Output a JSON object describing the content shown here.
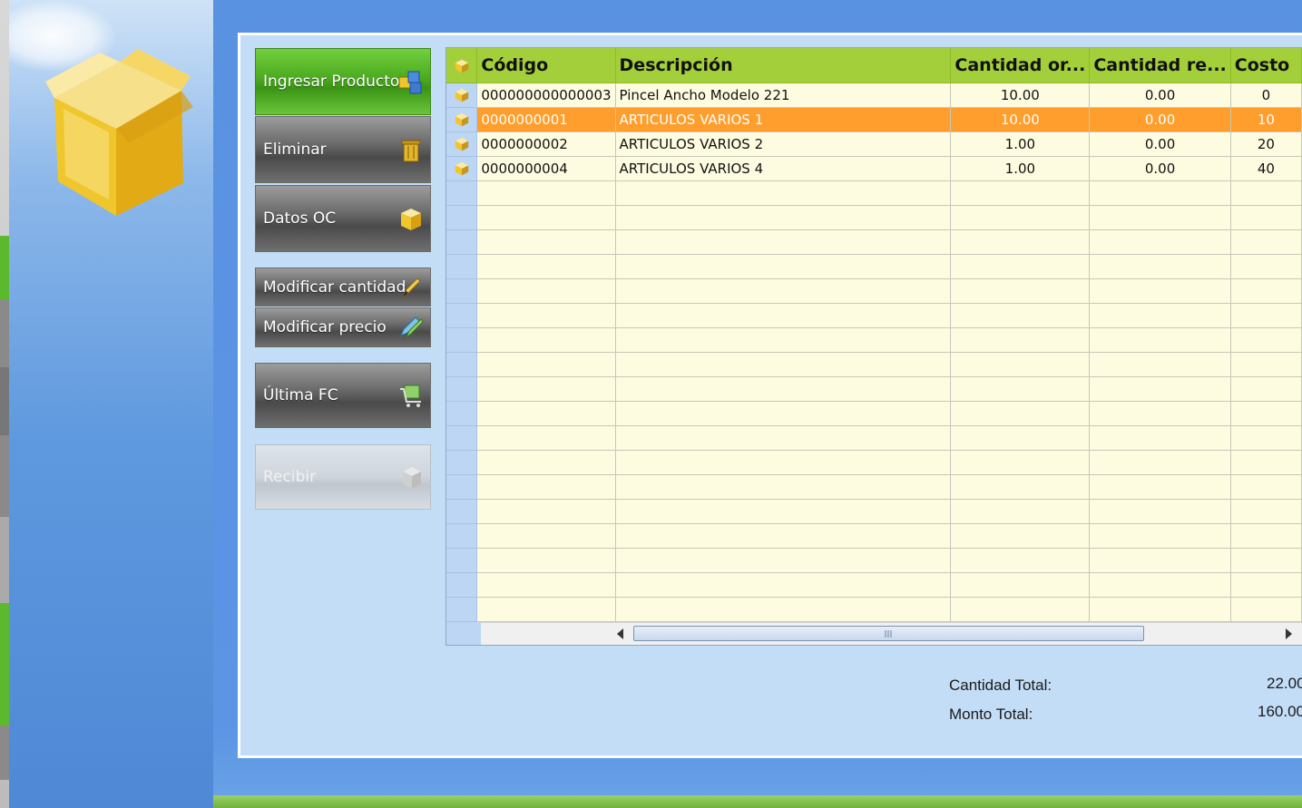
{
  "buttons": {
    "ingresar": "Ingresar Producto",
    "eliminar": "Eliminar",
    "datos_oc": "Datos OC",
    "modificar_cantidad": "Modificar cantidad",
    "modificar_precio": "Modificar precio",
    "ultima_fc": "Última FC",
    "recibir": "Recibir"
  },
  "grid": {
    "headers": {
      "codigo": "Código",
      "descripcion": "Descripción",
      "cantidad_or": "Cantidad or...",
      "cantidad_re": "Cantidad re...",
      "costo": "Costo"
    },
    "rows": [
      {
        "codigo": "000000000000003",
        "descripcion": "Pincel Ancho Modelo 221",
        "cantidad_or": "10.00",
        "cantidad_re": "0.00",
        "costo": "0"
      },
      {
        "codigo": "0000000001",
        "descripcion": "ARTICULOS VARIOS 1",
        "cantidad_or": "10.00",
        "cantidad_re": "0.00",
        "costo": "10"
      },
      {
        "codigo": "0000000002",
        "descripcion": "ARTICULOS VARIOS 2",
        "cantidad_or": "1.00",
        "cantidad_re": "0.00",
        "costo": "20"
      },
      {
        "codigo": "0000000004",
        "descripcion": "ARTICULOS VARIOS 4",
        "cantidad_or": "1.00",
        "cantidad_re": "0.00",
        "costo": "40"
      }
    ],
    "selected_row": 1
  },
  "totals": {
    "cantidad_label": "Cantidad Total:",
    "cantidad_value": "22.00",
    "monto_label": "Monto Total:",
    "monto_value": "160.00"
  },
  "colors": {
    "header_green": "#a3cf3a",
    "selected_orange": "#ff9e2c",
    "row_cream": "#fdfbe0",
    "panel_blue": "#c4ddf7"
  }
}
